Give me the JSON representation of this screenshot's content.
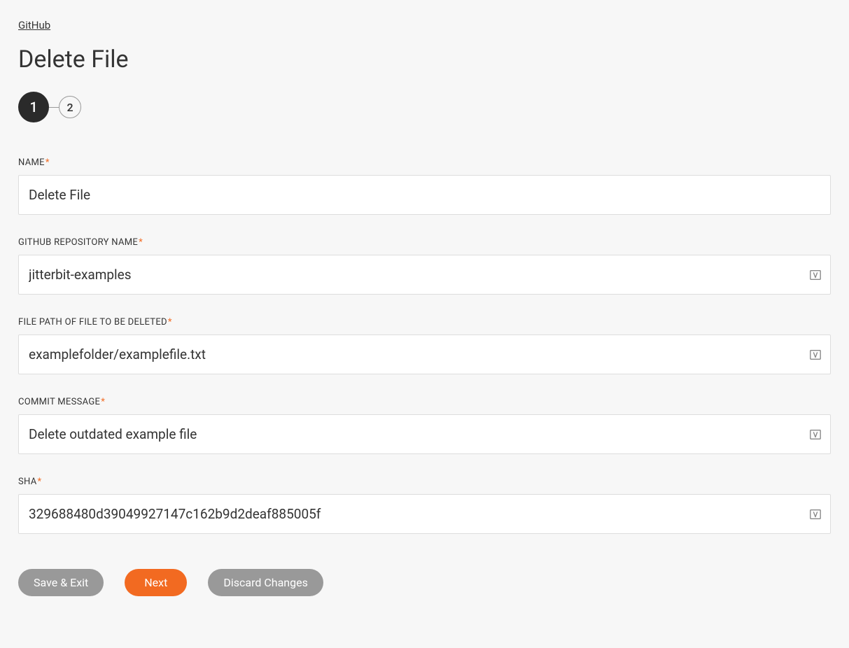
{
  "breadcrumb": {
    "label": "GitHub"
  },
  "page": {
    "title": "Delete File"
  },
  "stepper": {
    "steps": [
      "1",
      "2"
    ],
    "active_index": 0
  },
  "form": {
    "name": {
      "label": "NAME",
      "value": "Delete File",
      "required": true
    },
    "repo_name": {
      "label": "GITHUB REPOSITORY NAME",
      "value": "jitterbit-examples",
      "required": true,
      "has_variable_picker": true
    },
    "file_path": {
      "label": "FILE PATH OF FILE TO BE DELETED",
      "value": "examplefolder/examplefile.txt",
      "required": true,
      "has_variable_picker": true
    },
    "commit_message": {
      "label": "COMMIT MESSAGE",
      "value": "Delete outdated example file",
      "required": true,
      "has_variable_picker": true
    },
    "sha": {
      "label": "SHA",
      "value": "329688480d39049927147c162b9d2deaf885005f",
      "required": true,
      "has_variable_picker": true
    }
  },
  "buttons": {
    "save_exit": "Save & Exit",
    "next": "Next",
    "discard": "Discard Changes"
  }
}
